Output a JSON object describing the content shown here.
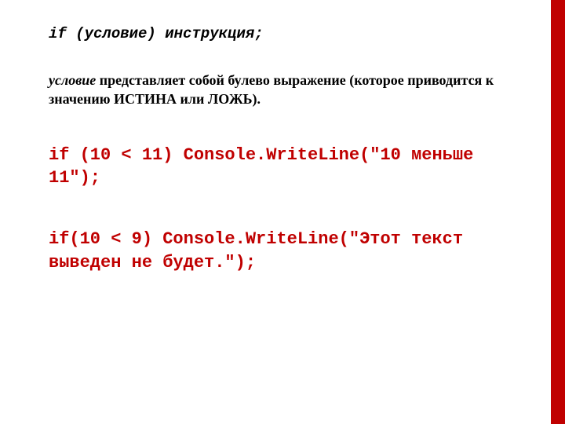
{
  "syntax": "if (условие) инструкция;",
  "description": {
    "italic_word": "условие",
    "rest": " представляет собой булево  выражение (которое приводится к значению ИСТИНА или ЛОЖЬ)."
  },
  "code1": "if (10 < 11) Console.WriteLine(\"10 меньше 11\");",
  "code2": "if(10 < 9) Console.WriteLine(\"Этот текст выведен не будет.\");"
}
